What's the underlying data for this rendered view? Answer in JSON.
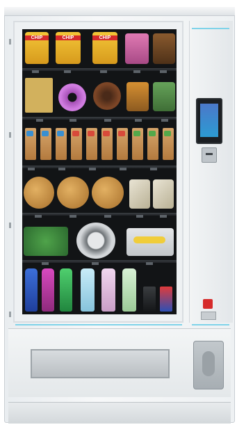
{
  "products": {
    "chip_label": "CHIP"
  },
  "panel": {
    "brand_mark": "",
    "touch_screen": "touch-screen",
    "card_reader": "card-reader"
  },
  "colors": {
    "accent": "#7fd3e9",
    "brand": "#d62b2b",
    "window": "#121416"
  }
}
